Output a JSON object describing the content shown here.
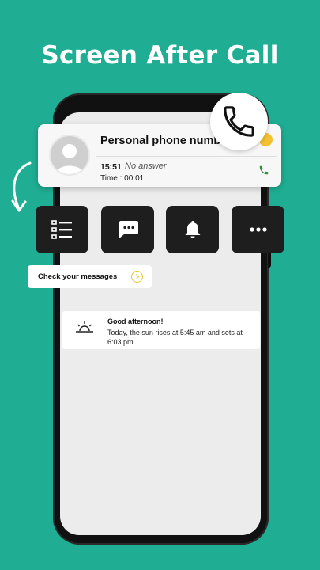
{
  "headline": "Screen After Call",
  "colors": {
    "background": "#1fae94",
    "button_bg": "#1e1e1e",
    "accent_yellow": "#f2c230",
    "call_green": "#2f8f3a"
  },
  "call_card": {
    "caller_name": "Personal phone number",
    "time": "15:51",
    "status": "No answer",
    "duration": "Time : 00:01"
  },
  "actions": [
    {
      "icon": "checklist-icon"
    },
    {
      "icon": "chat-bubble-icon"
    },
    {
      "icon": "bell-icon"
    },
    {
      "icon": "more-dots-icon"
    }
  ],
  "tooltip": {
    "label": "Check your messages",
    "icon": "arrow-right-circle-icon"
  },
  "greeting": {
    "title": "Good afternoon!",
    "body": "Today, the sun rises at 5:45 am and sets at 6:03 pm",
    "icon": "sunrise-icon"
  }
}
